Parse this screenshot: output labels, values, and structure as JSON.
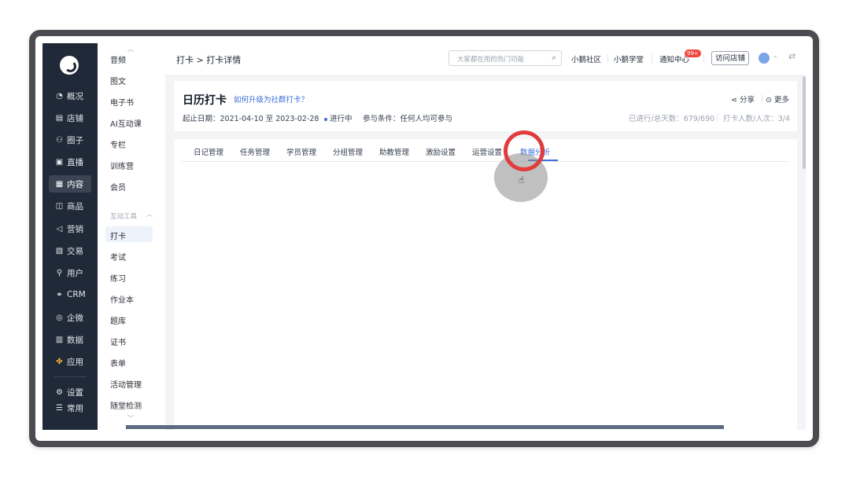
{
  "sidebar": {
    "items": [
      {
        "icon": "pie-chart-icon",
        "glyph": "◔",
        "label": "概况"
      },
      {
        "icon": "store-icon",
        "glyph": "▤",
        "label": "店铺"
      },
      {
        "icon": "circle-group-icon",
        "glyph": "⚇",
        "label": "圈子"
      },
      {
        "icon": "live-icon",
        "glyph": "▣",
        "label": "直播"
      },
      {
        "icon": "content-icon",
        "glyph": "▦",
        "label": "内容"
      },
      {
        "icon": "goods-icon",
        "glyph": "◫",
        "label": "商品"
      },
      {
        "icon": "marketing-icon",
        "glyph": "◁",
        "label": "营销"
      },
      {
        "icon": "trade-icon",
        "glyph": "▧",
        "label": "交易"
      },
      {
        "icon": "user-icon",
        "glyph": "⚲",
        "label": "用户"
      },
      {
        "icon": "crm-icon",
        "glyph": "⚭",
        "label": "CRM"
      },
      {
        "icon": "enterprise-wechat-icon",
        "glyph": "◎",
        "label": "企微"
      },
      {
        "icon": "data-icon",
        "glyph": "▥",
        "label": "数据"
      },
      {
        "icon": "apps-icon",
        "glyph": "✤",
        "label": "应用"
      },
      {
        "icon": "settings-icon",
        "glyph": "⚙",
        "label": "设置"
      },
      {
        "icon": "common-icon",
        "glyph": "☰",
        "label": "常用"
      }
    ]
  },
  "subnav": {
    "items": [
      "音频",
      "图文",
      "电子书",
      "AI互动课",
      "专栏",
      "训练营",
      "会员"
    ],
    "group_label": "互动工具",
    "tools": [
      "打卡",
      "考试",
      "练习",
      "作业本",
      "题库",
      "证书",
      "表单",
      "活动管理",
      "随堂检测"
    ]
  },
  "topbar": {
    "breadcrumb": "打卡 > 打卡详情",
    "search_placeholder": "大家都在用的热门功能",
    "links": [
      "小鹅社区",
      "小鹅学堂",
      "通知中心"
    ],
    "notification_badge": "99+",
    "visit_store": "访问店铺"
  },
  "checkin": {
    "title": "日历打卡",
    "upgrade_link": "如何升级为社群打卡？",
    "share": "分享",
    "more": "更多",
    "date_range": "起止日期：2021-04-10 至 2023-02-28",
    "status": "进行中",
    "condition": "参与条件：任何人均可参与",
    "progress": "已进行/总天数：679/690",
    "participants": "打卡人数/人次：3/4"
  },
  "tabs": [
    "日记管理",
    "任务管理",
    "学员管理",
    "分组管理",
    "助教管理",
    "激励设置",
    "运营设置",
    "数据分析"
  ],
  "colors": {
    "accent": "#3b6fd8",
    "sidebar": "#1f2937",
    "badge": "#f0463c",
    "click_indicator": "#e23b3b"
  }
}
